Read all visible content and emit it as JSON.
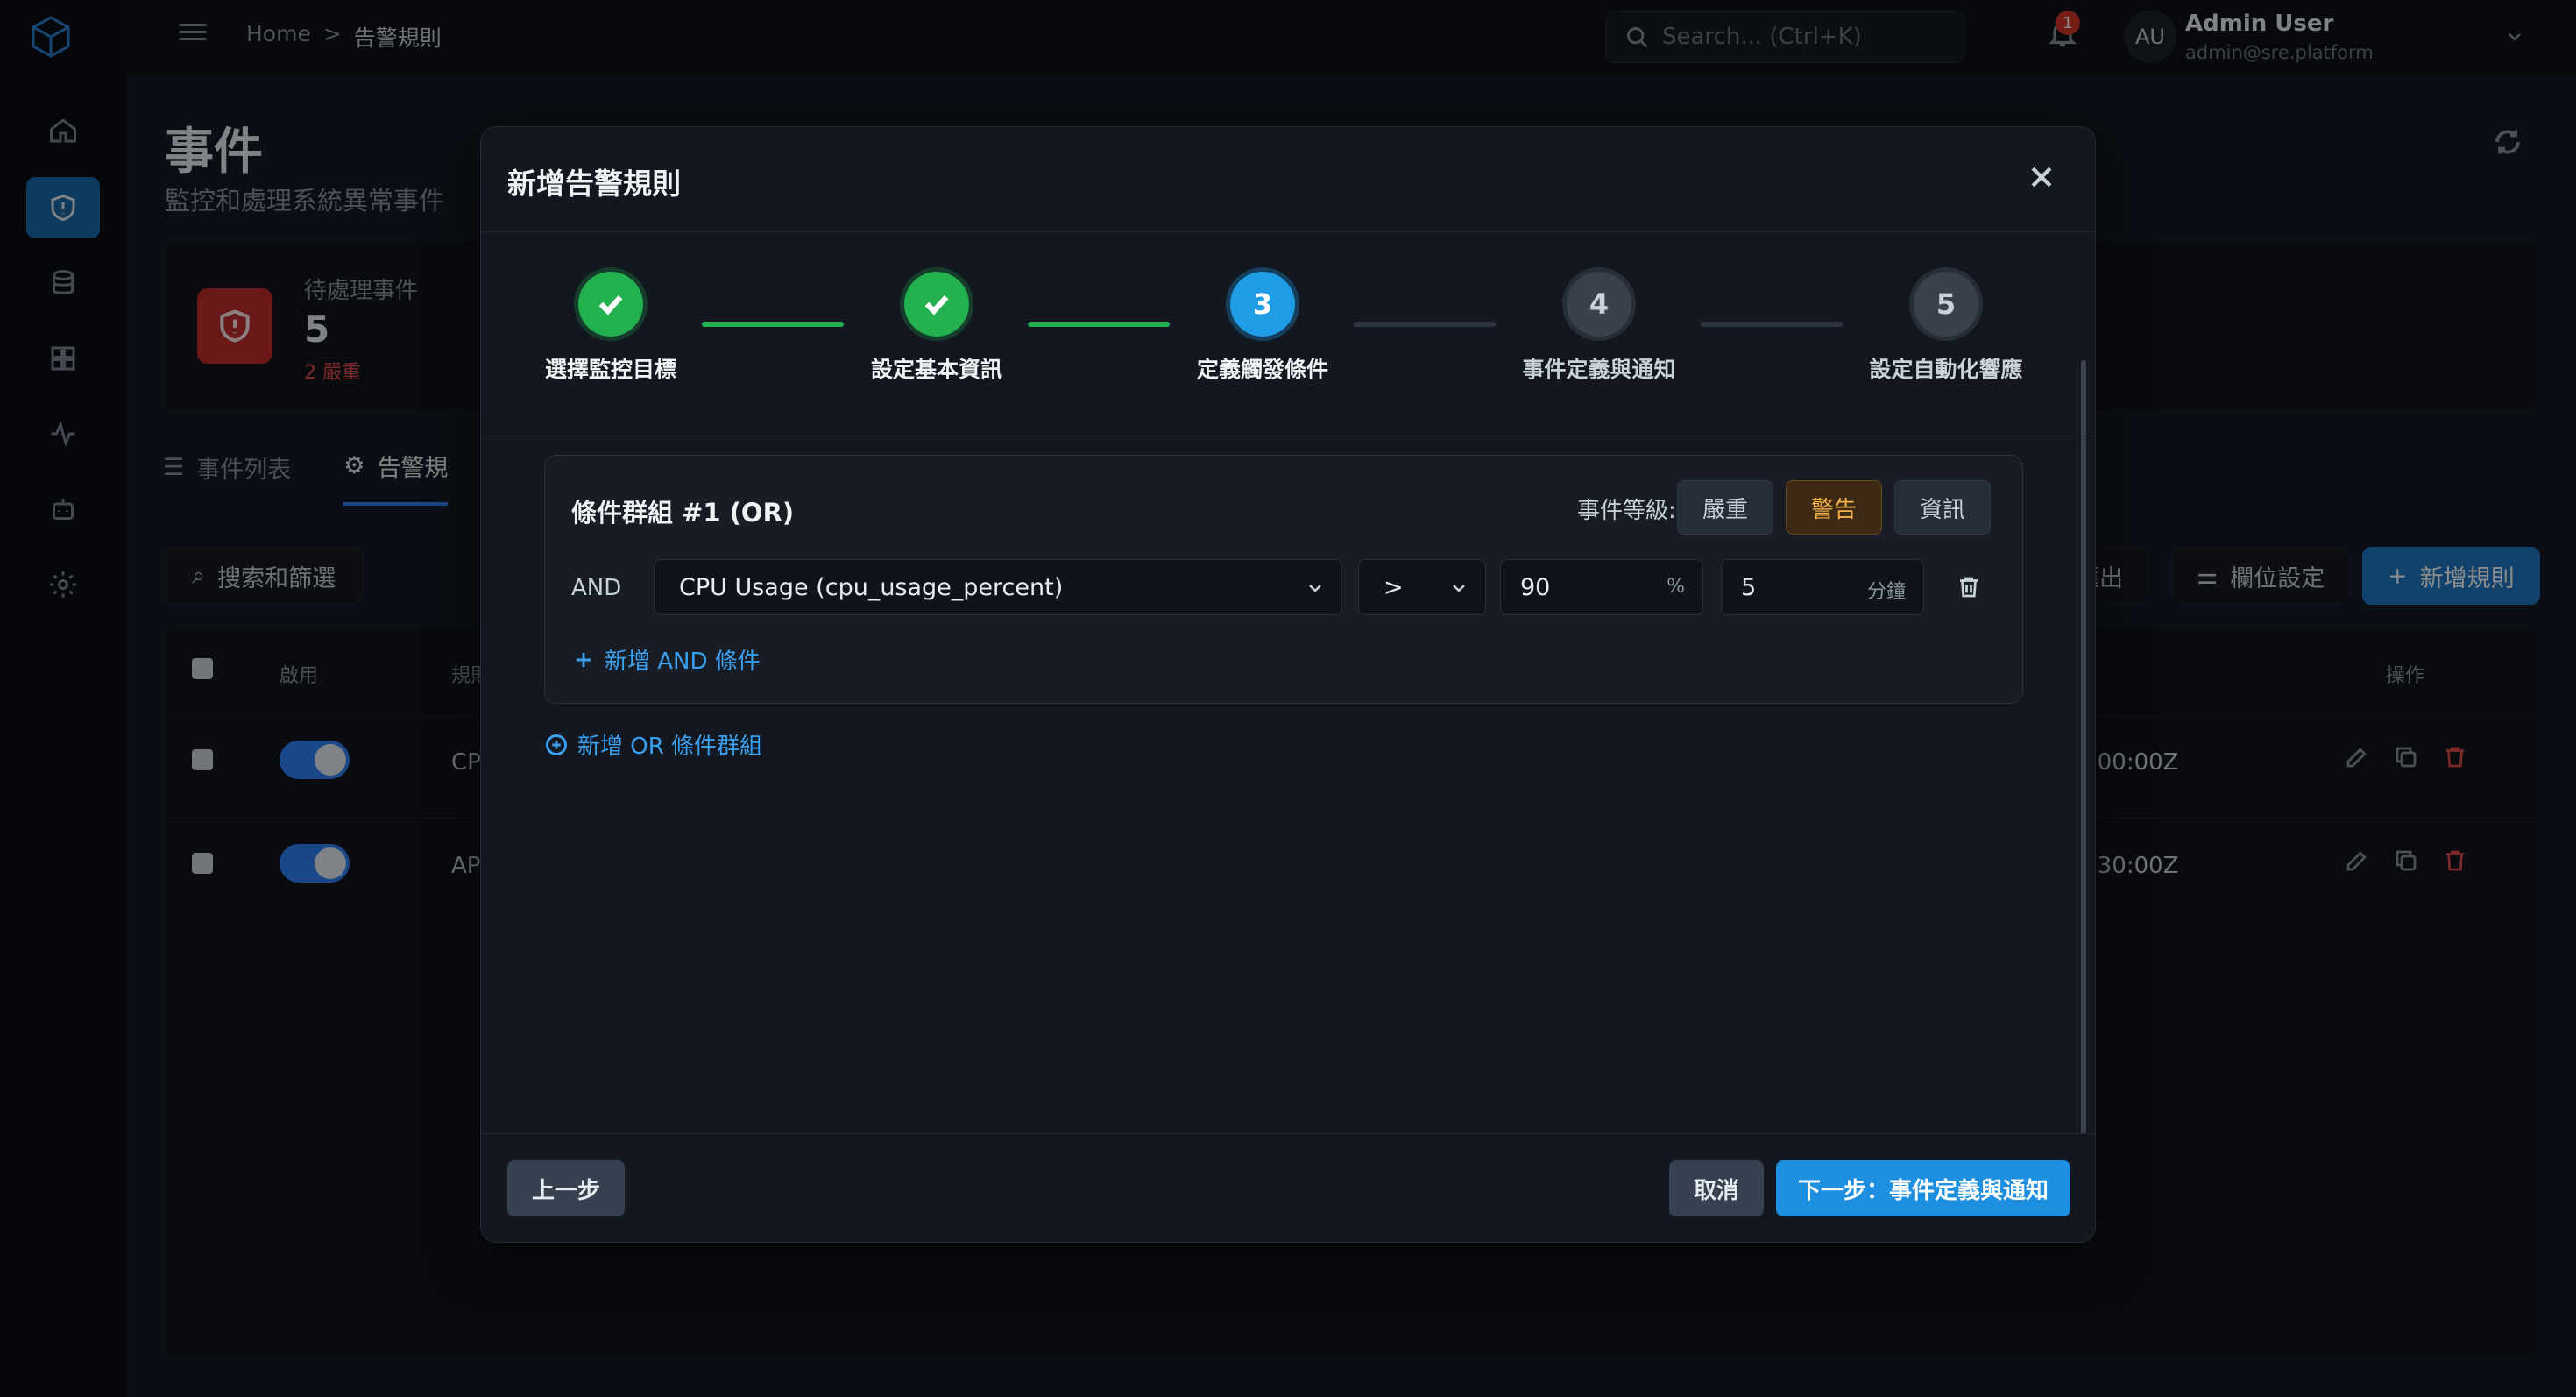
{
  "topbar": {
    "breadcrumb": [
      "Home",
      "告警規則"
    ],
    "breadcrumb_sep": ">",
    "search_placeholder": "Search... (Ctrl+K)",
    "notifications": "1",
    "avatar_initials": "AU",
    "user_name": "Admin User",
    "user_email": "admin@sre.platform"
  },
  "page": {
    "title": "事件",
    "subtitle": "監控和處理系統異常事件",
    "stat_label": "待處理事件",
    "stat_value": "5",
    "stat_sub": "2 嚴重",
    "tabs": [
      "事件列表",
      "告警規"
    ],
    "filter_label": "搜索和篩選",
    "toolbar": [
      "匯出",
      "欄位設定",
      "新增規則"
    ],
    "table_headers": [
      "啟用",
      "規則",
      "操作"
    ],
    "rows": [
      {
        "name": "CP",
        "time": ":00:00Z"
      },
      {
        "name": "AP",
        "time": ":30:00Z"
      }
    ]
  },
  "modal": {
    "title": "新增告警規則",
    "steps": [
      {
        "num": "1",
        "label": "選擇監控目標",
        "state": "done"
      },
      {
        "num": "2",
        "label": "設定基本資訊",
        "state": "done"
      },
      {
        "num": "3",
        "label": "定義觸發條件",
        "state": "current"
      },
      {
        "num": "4",
        "label": "事件定義與通知",
        "state": "todo"
      },
      {
        "num": "5",
        "label": "設定自動化響應",
        "state": "todo"
      }
    ],
    "condition_group": {
      "title": "條件群組 #1 (OR)",
      "severity_label": "事件等級:",
      "severities": [
        "嚴重",
        "警告",
        "資訊"
      ],
      "selected_severity": "警告",
      "condition": {
        "logic": "AND",
        "metric": "CPU Usage (cpu_usage_percent)",
        "operator": ">",
        "threshold": "90",
        "threshold_unit": "%",
        "duration": "5",
        "duration_unit": "分鐘"
      },
      "add_and": "新增 AND 條件"
    },
    "add_or": "新增 OR 條件群組",
    "footer": {
      "prev": "上一步",
      "cancel": "取消",
      "next": "下一步：事件定義與通知"
    }
  },
  "colors": {
    "primary": "#1d8fe0",
    "success": "#23b04f",
    "warning": "#f5b04a",
    "danger": "#d9342b"
  }
}
